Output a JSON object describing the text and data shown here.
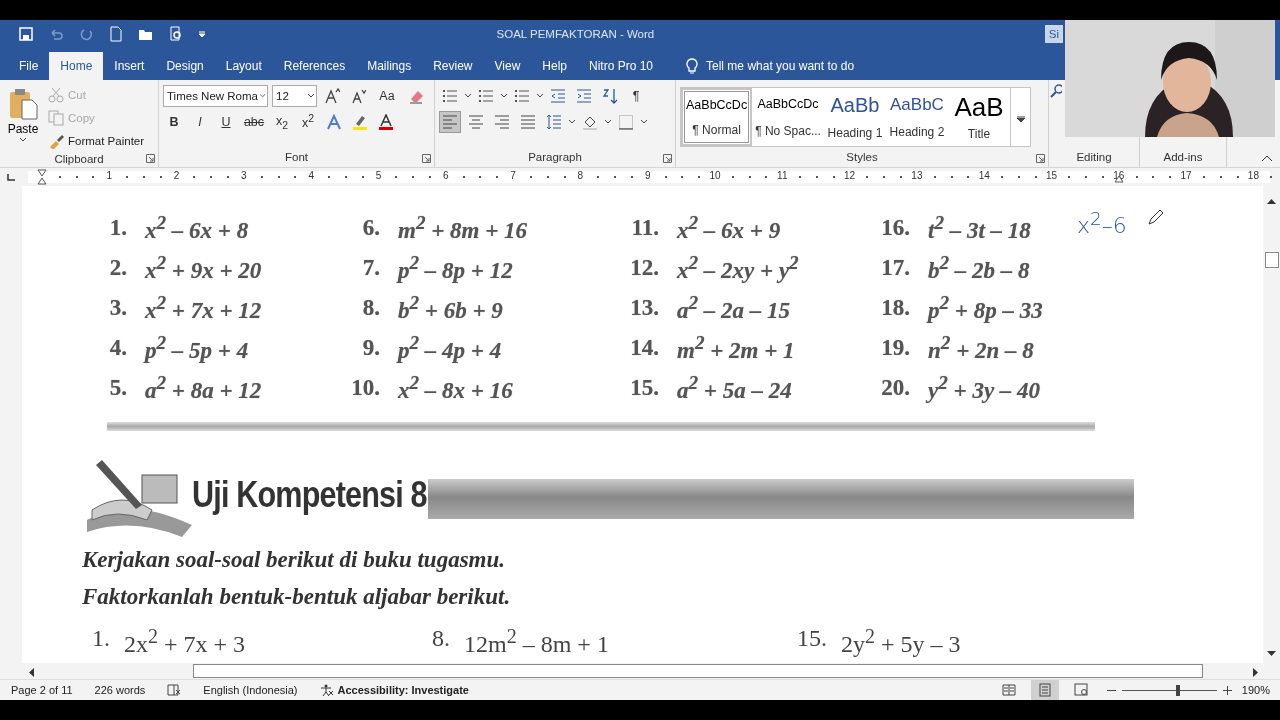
{
  "title_bar": {
    "title": "SOAL PEMFAKTORAN  -  Word",
    "sign_in": "Si"
  },
  "menu_tabs": [
    {
      "label": "File",
      "selected": false
    },
    {
      "label": "Home",
      "selected": true
    },
    {
      "label": "Insert",
      "selected": false
    },
    {
      "label": "Design",
      "selected": false
    },
    {
      "label": "Layout",
      "selected": false
    },
    {
      "label": "References",
      "selected": false
    },
    {
      "label": "Mailings",
      "selected": false
    },
    {
      "label": "Review",
      "selected": false
    },
    {
      "label": "View",
      "selected": false
    },
    {
      "label": "Help",
      "selected": false
    },
    {
      "label": "Nitro Pro 10",
      "selected": false
    }
  ],
  "tell_me": "Tell me what you want to do",
  "clipboard": {
    "paste": "Paste",
    "cut": {
      "label": "Cut",
      "disabled": true
    },
    "copy": {
      "label": "Copy",
      "disabled": true
    },
    "format_painter": "Format Painter",
    "label": "Clipboard"
  },
  "font": {
    "font_name": "Times New Roma",
    "font_size": "12",
    "change_case": "Aa",
    "format_buttons": [
      "B",
      "I",
      "U",
      "abc",
      "x$_{2}$",
      "x$^{2}$"
    ],
    "label": "Font"
  },
  "paragraph": {
    "pilcrow": "¶",
    "alignments": [
      {
        "kind": "left",
        "selected": true
      },
      {
        "kind": "center",
        "selected": false
      },
      {
        "kind": "right",
        "selected": false
      },
      {
        "kind": "justify",
        "selected": false
      }
    ],
    "label": "Paragraph"
  },
  "styles": {
    "items": [
      {
        "preview": "AaBbCcDc",
        "name": "¶ Normal",
        "kind": "normal",
        "selected": true
      },
      {
        "preview": "AaBbCcDc",
        "name": "¶ No Spac...",
        "kind": "normal",
        "selected": false
      },
      {
        "preview": "AaBb",
        "name": "Heading 1",
        "kind": "heading1",
        "selected": false
      },
      {
        "preview": "AaBbC",
        "name": "Heading 2",
        "kind": "heading2",
        "selected": false
      },
      {
        "preview": "AaB",
        "name": "Title",
        "kind": "title",
        "selected": false
      }
    ],
    "label": "Styles"
  },
  "editing": {
    "label": "Editing"
  },
  "addins": {
    "label": "Add-ins"
  },
  "ruler_marks": [
    "1",
    "2",
    "3",
    "4",
    "5",
    "6",
    "7",
    "8",
    "9",
    "10",
    "11",
    "12",
    "13",
    "14",
    "15",
    "16",
    "17",
    "18"
  ],
  "document": {
    "problems": [
      {
        "number": "1.",
        "expr": "x$^{2}$ – 6x + 8"
      },
      {
        "number": "6.",
        "expr": "m$^{2}$ + 8m + 16"
      },
      {
        "number": "11.",
        "expr": "x$^{2}$ – 6x + 9"
      },
      {
        "number": "16.",
        "expr": "t$^{2}$ – 3t – 18"
      },
      {
        "number": "2.",
        "expr": "x$^{2}$ + 9x + 20"
      },
      {
        "number": "7.",
        "expr": "p$^{2}$ – 8p + 12"
      },
      {
        "number": "12.",
        "expr": "x$^{2}$ – 2xy + y$^{2}$"
      },
      {
        "number": "17.",
        "expr": "b$^{2}$ – 2b – 8"
      },
      {
        "number": "3.",
        "expr": "x$^{2}$ + 7x + 12"
      },
      {
        "number": "8.",
        "expr": "b$^{2}$ + 6b + 9"
      },
      {
        "number": "13.",
        "expr": "a$^{2}$ – 2a – 15"
      },
      {
        "number": "18.",
        "expr": "p$^{2}$ + 8p – 33"
      },
      {
        "number": "4.",
        "expr": "p$^{2}$ – 5p + 4"
      },
      {
        "number": "9.",
        "expr": "p$^{2}$ – 4p + 4"
      },
      {
        "number": "14.",
        "expr": "m$^{2}$ + 2m + 1"
      },
      {
        "number": "19.",
        "expr": "n$^{2}$ + 2n – 8"
      },
      {
        "number": "5.",
        "expr": "a$^{2}$ + 8a + 12"
      },
      {
        "number": "10.",
        "expr": "x$^{2}$ – 8x + 16"
      },
      {
        "number": "15.",
        "expr": "a$^{2}$ + 5a – 24"
      },
      {
        "number": "20.",
        "expr": "y$^{2}$ + 3y – 40"
      }
    ],
    "handwriting": "x$^{2}$–6",
    "section_title": "Uji Kompetensi 8",
    "instructions": [
      "Kerjakan soal-soal berikut di buku tugasmu.",
      "Faktorkanlah bentuk-bentuk aljabar berikut."
    ],
    "exercises": [
      {
        "number": "1.",
        "expr": "2x$^{2}$ + 7x + 3"
      },
      {
        "number": "8.",
        "expr": "12m$^{2}$ – 8m + 1"
      },
      {
        "number": "15.",
        "expr": "2y$^{2}$ + 5y – 3"
      }
    ]
  },
  "status_bar": {
    "page": "Page 2 of 11",
    "words": "226 words",
    "language": "English (Indonesia)",
    "accessibility": "Accessibility: Investigate",
    "views": [
      {
        "kind": "read",
        "selected": false
      },
      {
        "kind": "print",
        "selected": true
      },
      {
        "kind": "web",
        "selected": false
      }
    ],
    "zoom_slider": {
      "level": 0.59
    },
    "zoom": "190%"
  }
}
